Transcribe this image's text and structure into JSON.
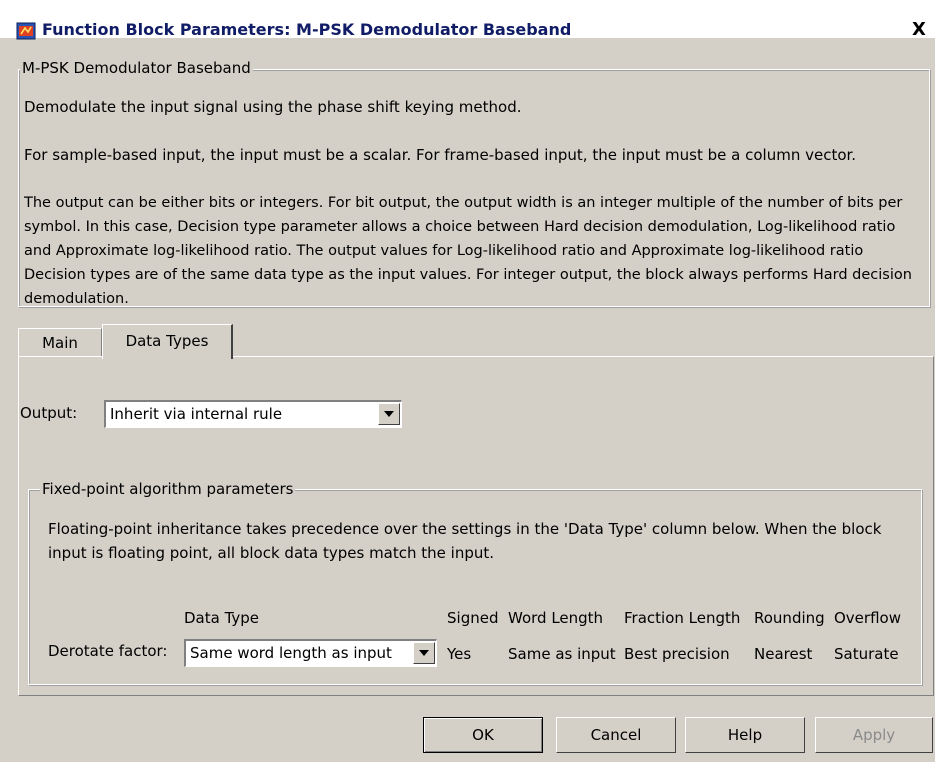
{
  "window": {
    "title": "Function Block Parameters: M-PSK Demodulator Baseband",
    "close_label": "X"
  },
  "description_group": {
    "legend": "M-PSK Demodulator Baseband",
    "paragraphs": [
      "Demodulate the input signal using the phase shift keying method.",
      "For sample-based input, the input must be a scalar. For frame-based input, the input must be a column vector.",
      "The output can be either bits or integers. For bit output, the output width is an integer multiple of the number of bits per symbol. In this case, Decision type parameter allows a choice between Hard decision demodulation, Log-likelihood ratio and Approximate log-likelihood ratio. The output values for Log-likelihood ratio and Approximate log-likelihood ratio Decision types are of the same data type as the input values. For integer output, the block always performs Hard decision demodulation."
    ]
  },
  "tabs": [
    {
      "label": "Main",
      "active": false
    },
    {
      "label": "Data Types",
      "active": true
    }
  ],
  "output": {
    "label": "Output:",
    "value": "Inherit via internal rule"
  },
  "fixed_point": {
    "legend": "Fixed-point algorithm parameters",
    "note": "Floating-point inheritance takes precedence over the settings in the 'Data Type' column below. When the block input is floating point, all block data types match the input.",
    "columns": {
      "data_type": "Data Type",
      "signed": "Signed",
      "word_length": "Word Length",
      "fraction_length": "Fraction Length",
      "rounding": "Rounding",
      "overflow": "Overflow"
    },
    "row": {
      "label": "Derotate factor:",
      "data_type": "Same word length as input",
      "signed": "Yes",
      "word_length": "Same as input",
      "fraction_length": "Best precision",
      "rounding": "Nearest",
      "overflow": "Saturate"
    }
  },
  "buttons": {
    "ok": "OK",
    "cancel": "Cancel",
    "help": "Help",
    "apply": "Apply"
  },
  "icons": {
    "title_icon": "simulink-block-icon",
    "dropdown": "chevron-down-icon"
  }
}
